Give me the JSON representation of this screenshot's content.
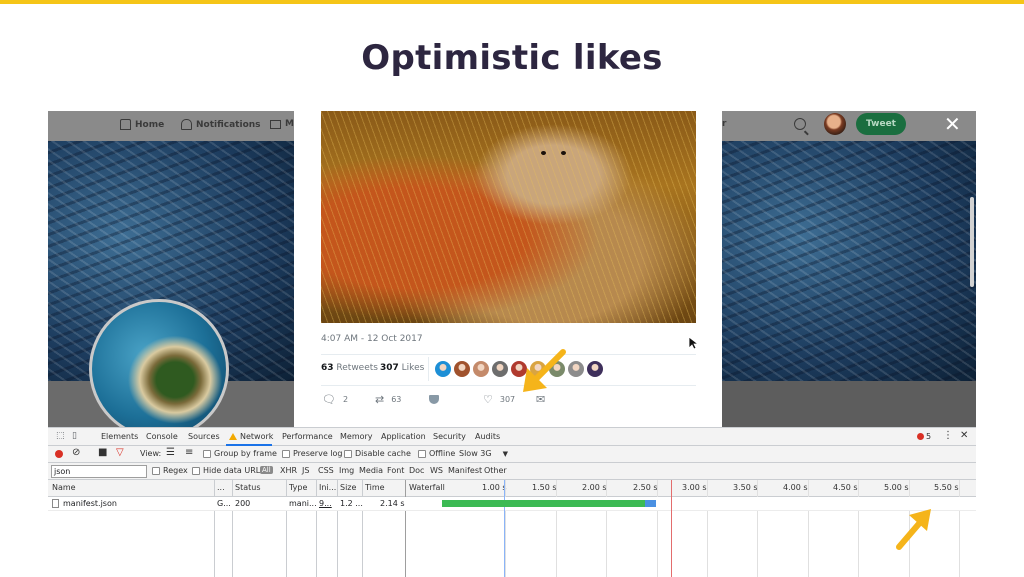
{
  "slide": {
    "title": "Optimistic likes",
    "accent": "#f5c518"
  },
  "twitter_nav": {
    "home": "Home",
    "notifications": "Notifications",
    "messages_partial": "M",
    "search_partial": "r",
    "tweet_button": "Tweet",
    "close_glyph": "✕"
  },
  "tweet": {
    "timestamp": "4:07 AM - 12 Oct 2017",
    "retweets_count": "63",
    "retweets_label": "Retweets",
    "likes_count": "307",
    "likes_label": "Likes",
    "actions": {
      "replies": "2",
      "retweets": "63",
      "likes": "307"
    },
    "liker_colors": [
      "#1d8fd6",
      "#a0522d",
      "#c48a6a",
      "#6d6d6d",
      "#b03a2e",
      "#d9a441",
      "#7a8a6a",
      "#8c8c8c",
      "#3e2f5b"
    ],
    "like_color": "#6e767d"
  },
  "devtools": {
    "tabs": [
      "Elements",
      "Console",
      "Sources",
      "Network",
      "Performance",
      "Memory",
      "Application",
      "Security",
      "Audits"
    ],
    "active_tab": "Network",
    "error_count": "5",
    "menu_glyph": "⋮",
    "close_glyph": "✕",
    "toolbar": {
      "view_label": "View:",
      "group_by_frame": "Group by frame",
      "preserve_log": "Preserve log",
      "disable_cache": "Disable cache",
      "offline": "Offline",
      "throttle": "Slow 3G"
    },
    "filter": {
      "value": "json",
      "regex": "Regex",
      "hide_data_urls": "Hide data URLs",
      "all": "All",
      "types": [
        "XHR",
        "JS",
        "CSS",
        "Img",
        "Media",
        "Font",
        "Doc",
        "WS",
        "Manifest",
        "Other"
      ]
    },
    "columns": {
      "name": "Name",
      "domain": "...",
      "status": "Status",
      "type": "Type",
      "initiator": "Ini...",
      "size": "Size",
      "time": "Time",
      "waterfall": "Waterfall"
    },
    "ticks": [
      "1.00 s",
      "1.50 s",
      "2.00 s",
      "2.50 s",
      "3.00 s",
      "3.50 s",
      "4.00 s",
      "4.50 s",
      "5.00 s",
      "5.50 s"
    ],
    "rows": [
      {
        "name": "manifest.json",
        "domain": "G...",
        "status": "200",
        "type": "mani...",
        "initiator": "9...",
        "size": "1.2 ...",
        "time": "2.14 s",
        "waterfall_start_s": 0.5,
        "waterfall_end_s": 2.64
      }
    ],
    "colors": {
      "receiving": "#3cba54",
      "waiting": "#4a90e2",
      "load_line": "#e36d6d"
    }
  },
  "annotations": {
    "arrow_color": "#f5b41a"
  }
}
